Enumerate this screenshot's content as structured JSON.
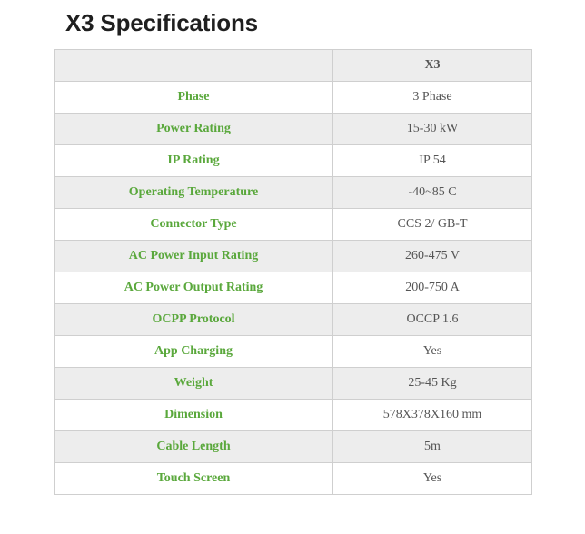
{
  "page": {
    "title": "X3 Specifications"
  },
  "table": {
    "header": {
      "spec": "",
      "model": "X3"
    },
    "rows": [
      {
        "label": "Phase",
        "value": "3 Phase"
      },
      {
        "label": "Power Rating",
        "value": "15-30 kW"
      },
      {
        "label": "IP Rating",
        "value": "IP 54"
      },
      {
        "label": "Operating Temperature",
        "value": "-40~85 C"
      },
      {
        "label": "Connector Type",
        "value": "CCS 2/ GB-T"
      },
      {
        "label": "AC Power Input Rating",
        "value": "260-475 V"
      },
      {
        "label": "AC Power Output Rating",
        "value": "200-750 A"
      },
      {
        "label": "OCPP Protocol",
        "value": "OCCP 1.6"
      },
      {
        "label": "App Charging",
        "value": "Yes"
      },
      {
        "label": "Weight",
        "value": "25-45 Kg"
      },
      {
        "label": "Dimension",
        "value": "578X378X160 mm"
      },
      {
        "label": "Cable Length",
        "value": "5m"
      },
      {
        "label": "Touch Screen",
        "value": "Yes"
      }
    ]
  },
  "colors": {
    "label_text": "#5aa83c",
    "value_text": "#555555",
    "row_shade": "#ededed",
    "border": "#cfcfcf"
  }
}
